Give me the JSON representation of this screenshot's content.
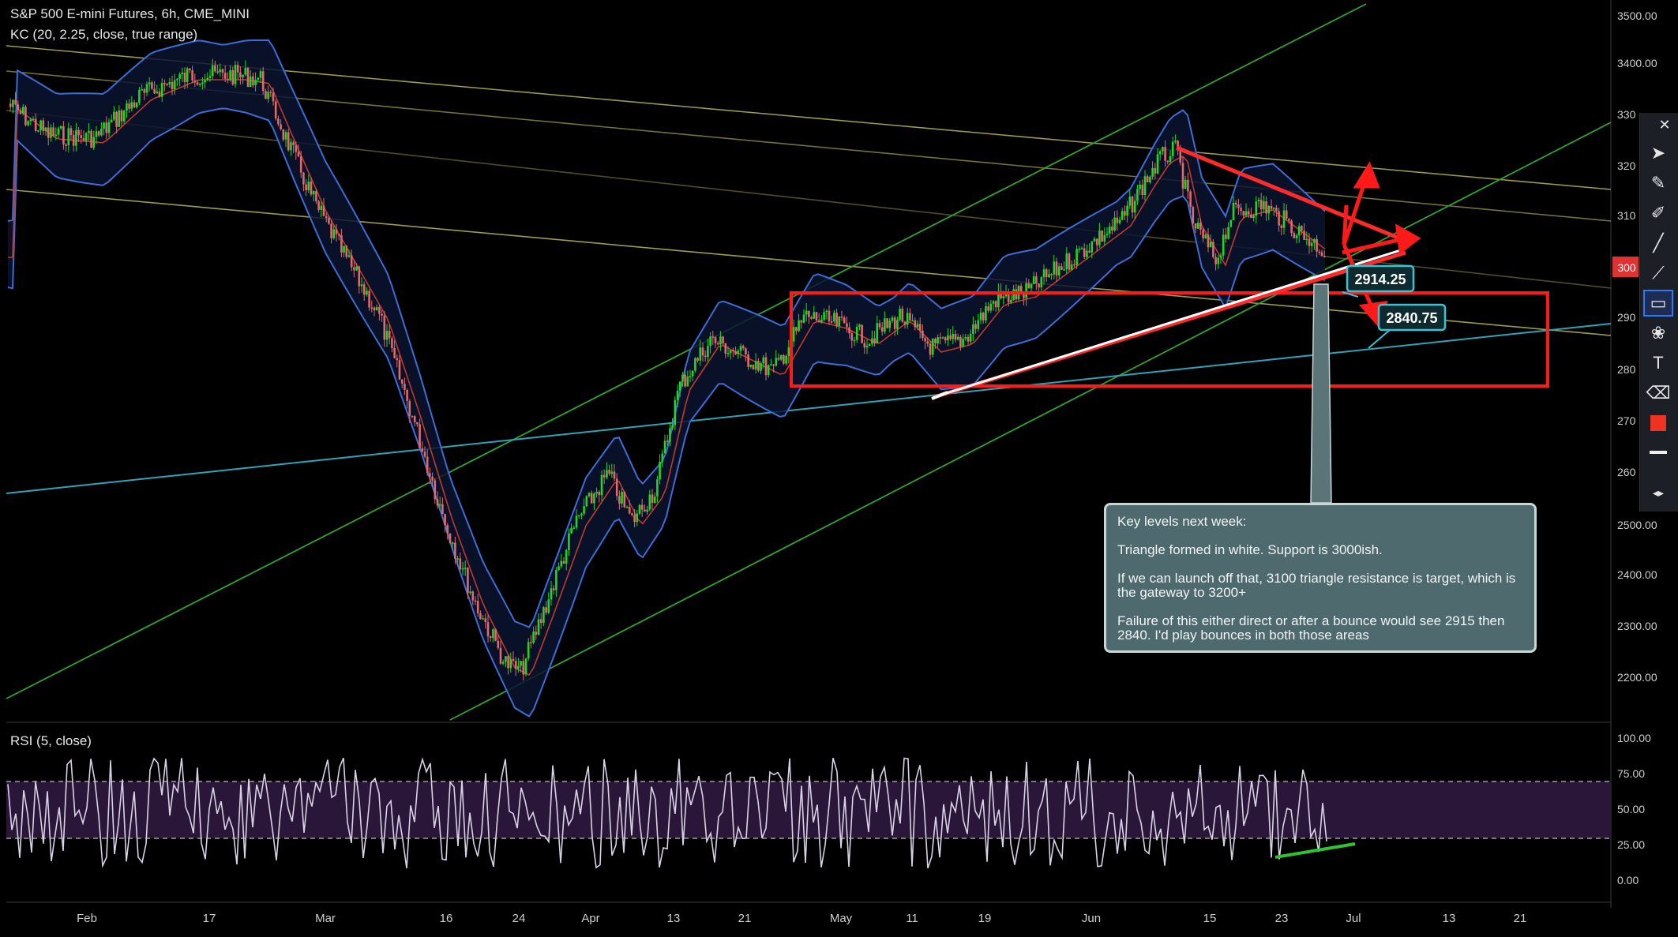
{
  "header": {
    "symbol_line": "S&P 500 E-mini Futures, 6h, CME_MINI",
    "indicator_line": "KC (20, 2.25, close, true range)"
  },
  "rsi": {
    "title": "RSI (5, close)"
  },
  "colors": {
    "background": "#000000",
    "up_candle": "#1fd81f",
    "down_candle": "#e06a6a",
    "kc_band": "#3d6dd6",
    "kc_mid": "#c0392b",
    "green_channel": "#2fa52f",
    "yellow_lines": "#a09a4a",
    "cyan_line": "#2fa3b8",
    "annotation_red": "#ff1a1a",
    "triangle_white": "#ffffff",
    "rsi_line": "#d9d2e6",
    "rsi_band": "#2a1638"
  },
  "price_labels": {
    "label_2914": "2914.25",
    "label_2840": "2840.75",
    "current_marker": "300"
  },
  "note": {
    "heading": "Key levels next week:",
    "line1": "Triangle formed in white. Support is 3000ish.",
    "line2": "If we can launch off that, 3100 triangle resistance is target, which is the gateway to 3200+",
    "line3": "Failure of this either direct or after a bounce would see 2915 then 2840. I'd play bounces in both those areas"
  },
  "toolbar": {
    "icons": [
      "cursor-icon",
      "pencil-icon",
      "marker-icon",
      "line-icon",
      "brush-icon",
      "rectangle-icon",
      "shapes-icon",
      "text-icon",
      "eraser-icon",
      "color-swatch-icon",
      "stroke-icon",
      "arrows-icon"
    ]
  },
  "chart_data": [
    {
      "type": "line",
      "title": "S&P 500 E-mini Futures, 6h, CME_MINI",
      "series": [
        {
          "name": "KC (20, 2.25, close, true range)",
          "x": [
            "Feb",
            "17",
            "Mar",
            "16",
            "24",
            "Apr",
            "13",
            "21",
            "May",
            "11",
            "19",
            "Jun",
            "15",
            "23",
            "Jul",
            "13",
            "21"
          ],
          "values": [
            3300,
            3380,
            3150,
            2600,
            2250,
            2530,
            2780,
            2860,
            2880,
            2860,
            2950,
            3050,
            3000,
            3050,
            3050,
            null,
            null
          ]
        }
      ],
      "y_tick_labels": [
        "3500.00",
        "3400.00",
        "330",
        "320",
        "310",
        "300",
        "290",
        "280",
        "270",
        "260",
        "2500.00",
        "2400.00",
        "2300.00",
        "2200.00"
      ],
      "x_tick_labels": [
        "Feb",
        "17",
        "Mar",
        "16",
        "24",
        "Apr",
        "13",
        "21",
        "May",
        "11",
        "19",
        "Jun",
        "15",
        "23",
        "Jul",
        "13",
        "21"
      ],
      "annotations": [
        "2914.25",
        "2840.75",
        "Key levels next week:"
      ]
    },
    {
      "type": "line",
      "title": "RSI (5, close)",
      "y_tick_labels": [
        "100.00",
        "75.00",
        "50.00",
        "25.00",
        "0.00"
      ],
      "ylim": [
        0,
        100
      ],
      "band": [
        30,
        70
      ]
    }
  ]
}
